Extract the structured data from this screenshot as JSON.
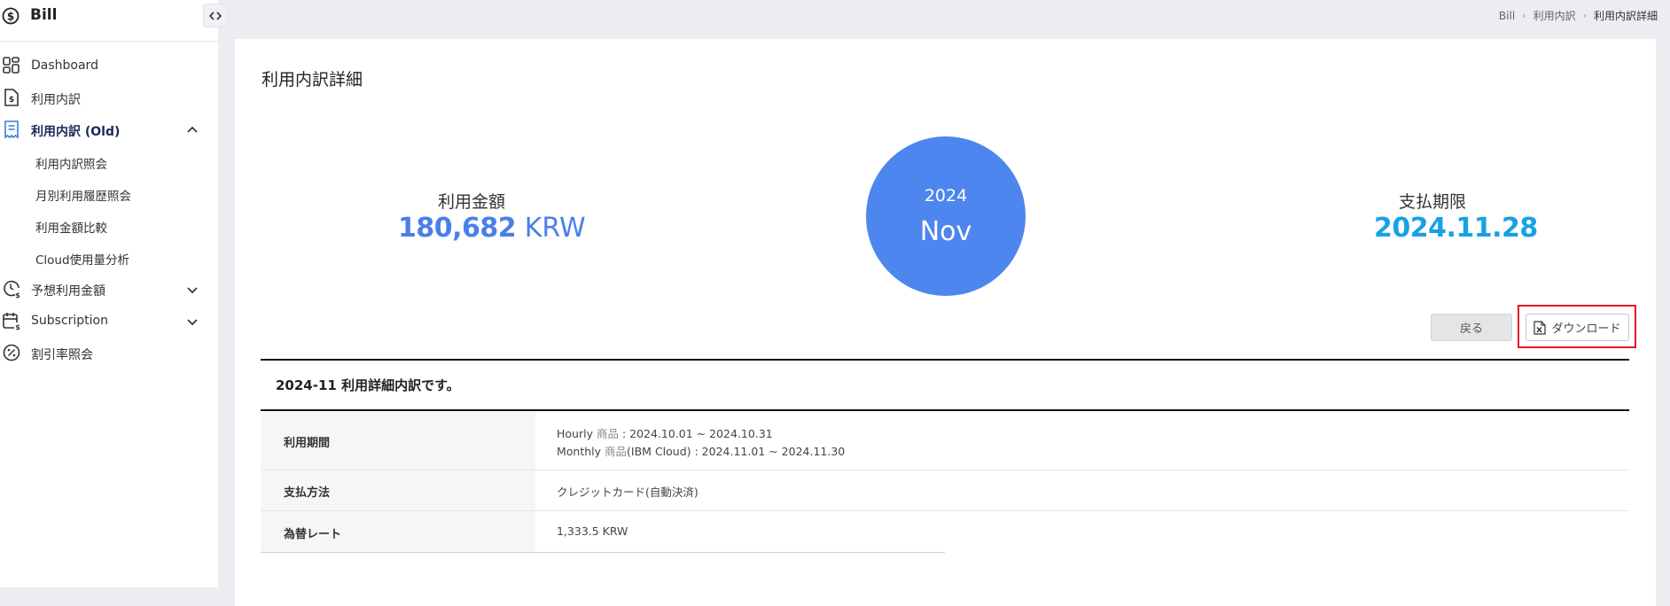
{
  "app": {
    "title": "Bill"
  },
  "sidebar": {
    "items": [
      {
        "label": "Dashboard"
      },
      {
        "label": "利用内訳"
      },
      {
        "label": "利用内訳 (Old)"
      },
      {
        "label": "予想利用金額"
      },
      {
        "label": "Subscription"
      },
      {
        "label": "割引率照会"
      }
    ],
    "subitems": [
      {
        "label": "利用内訳照会"
      },
      {
        "label": "月別利用履歴照会"
      },
      {
        "label": "利用金額比較"
      },
      {
        "label": "Cloud使用量分析"
      }
    ]
  },
  "breadcrumb": [
    "Bill",
    "利用内訳",
    "利用内訳詳細"
  ],
  "page": {
    "title": "利用内訳詳細"
  },
  "summary": {
    "amount_label": "利用金額",
    "amount_value": "180,682",
    "amount_currency": "KRW",
    "year": "2024",
    "month": "Nov",
    "due_label": "支払期限",
    "due_date": "2024.11.28"
  },
  "buttons": {
    "back": "戻る",
    "download": "ダウンロード"
  },
  "section": {
    "title": "2024-11 利用詳細内訳です。"
  },
  "details": {
    "period_label": "利用期間",
    "period_lines": [
      {
        "prefix": "Hourly ",
        "kind": "商品",
        "rest": " : 2024.10.01 ~ 2024.10.31"
      },
      {
        "prefix": "Monthly ",
        "kind": "商品",
        "rest": "(IBM Cloud) : 2024.11.01 ~ 2024.11.30"
      }
    ],
    "payment_label": "支払方法",
    "payment_value": "クレジットカード(自動決済)",
    "rate_label": "為替レート",
    "rate_value": "1,333.5 KRW"
  },
  "colors": {
    "accent": "#4d86ee",
    "amount": "#4a7fe8",
    "due": "#17a2e3",
    "highlight": "#e01b24"
  }
}
